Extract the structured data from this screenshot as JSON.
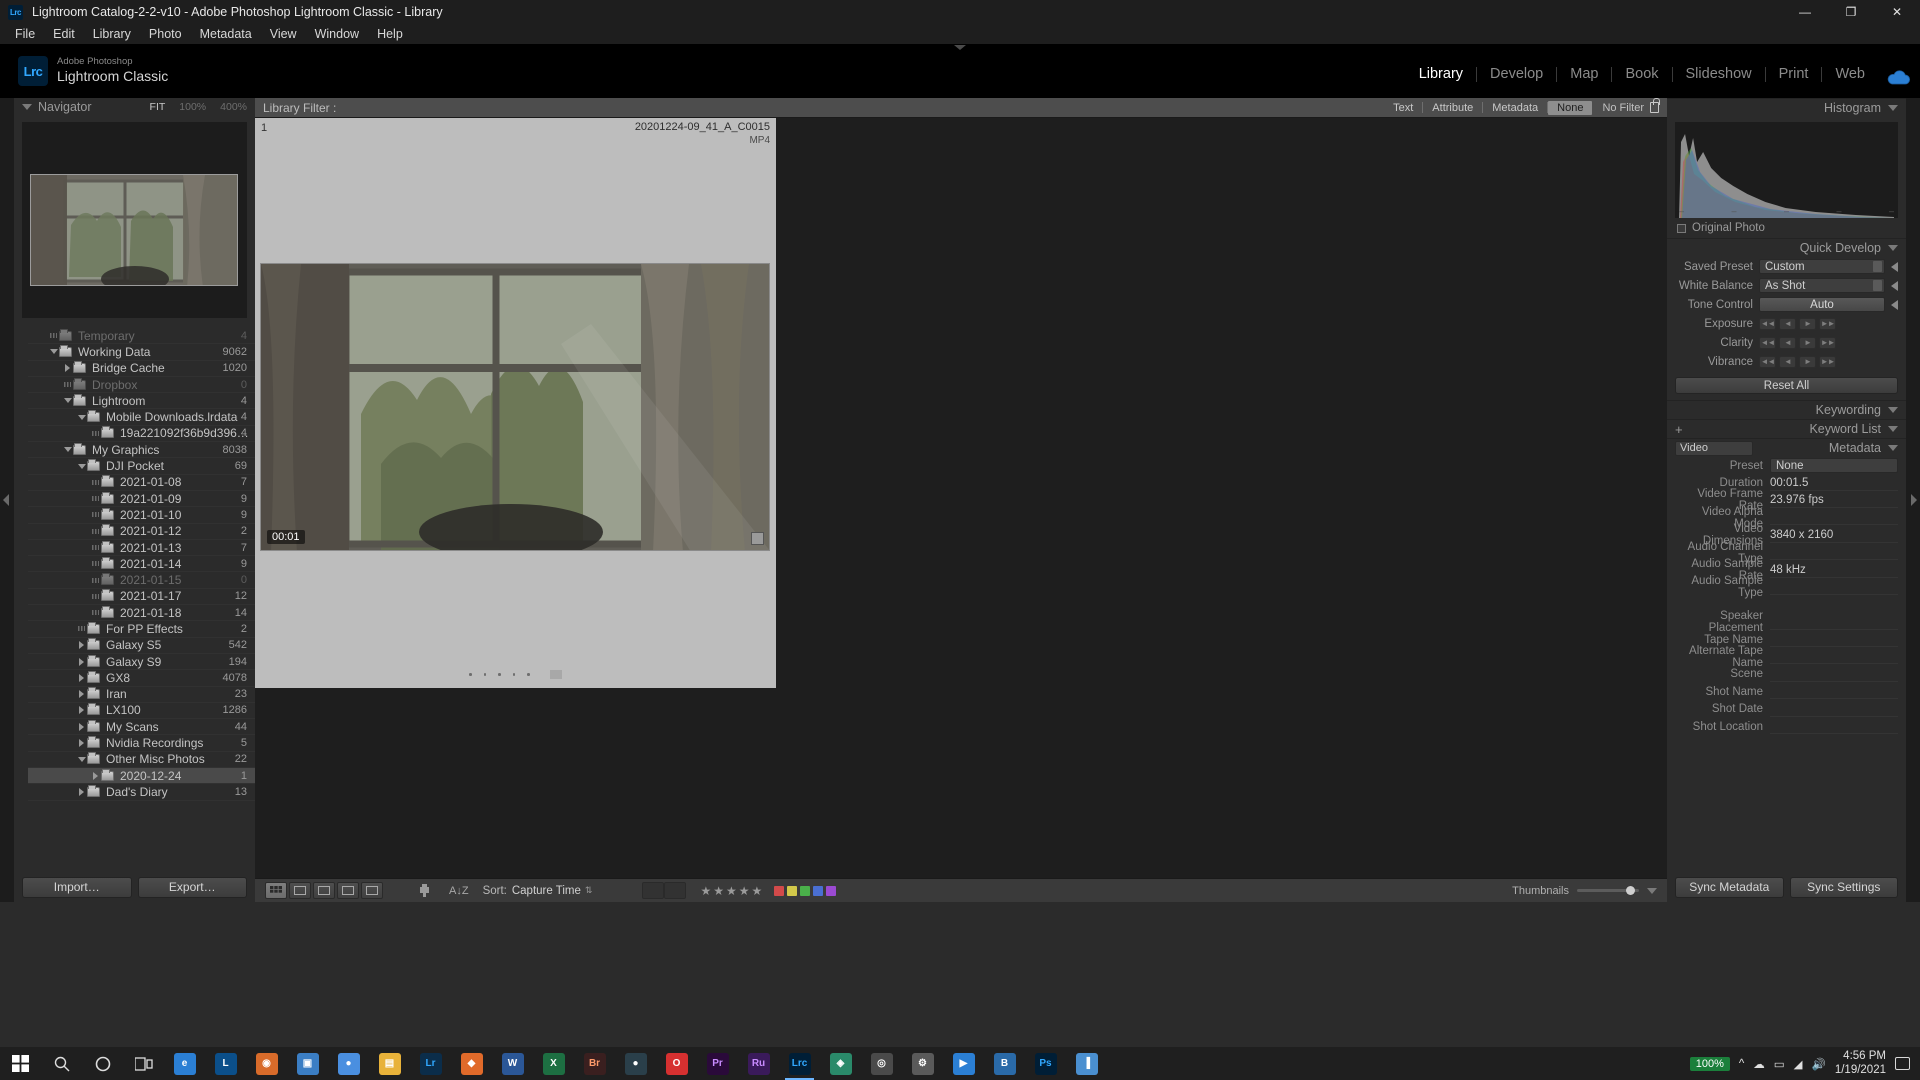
{
  "window": {
    "title": "Lightroom Catalog-2-2-v10 - Adobe Photoshop Lightroom Classic - Library",
    "app_badge": "Lrc",
    "minimize": "—",
    "maximize": "❐",
    "close": "✕"
  },
  "menu": [
    "File",
    "Edit",
    "Library",
    "Photo",
    "Metadata",
    "View",
    "Window",
    "Help"
  ],
  "identity": {
    "line1": "Adobe Photoshop",
    "line2": "Lightroom Classic",
    "badge": "Lrc"
  },
  "modules": [
    {
      "label": "Library",
      "active": true
    },
    {
      "label": "Develop",
      "active": false
    },
    {
      "label": "Map",
      "active": false
    },
    {
      "label": "Book",
      "active": false
    },
    {
      "label": "Slideshow",
      "active": false
    },
    {
      "label": "Print",
      "active": false
    },
    {
      "label": "Web",
      "active": false
    }
  ],
  "navigator": {
    "title": "Navigator",
    "zoom_levels": [
      {
        "label": "FIT",
        "active": true
      },
      {
        "label": "100%",
        "active": false
      },
      {
        "label": "400%",
        "active": false
      }
    ]
  },
  "folders": [
    {
      "name": "Temporary",
      "count": "4",
      "indent": 1,
      "twisty": "dots",
      "dim": true,
      "selected": false
    },
    {
      "name": "Working Data",
      "count": "9062",
      "indent": 1,
      "twisty": "down",
      "dim": false,
      "selected": false
    },
    {
      "name": "Bridge Cache",
      "count": "1020",
      "indent": 2,
      "twisty": "right",
      "dim": false,
      "selected": false
    },
    {
      "name": "Dropbox",
      "count": "0",
      "indent": 2,
      "twisty": "dots",
      "dim": true,
      "selected": false
    },
    {
      "name": "Lightroom",
      "count": "4",
      "indent": 2,
      "twisty": "down",
      "dim": false,
      "selected": false
    },
    {
      "name": "Mobile Downloads.lrdata",
      "count": "4",
      "indent": 3,
      "twisty": "down",
      "dim": false,
      "selected": false
    },
    {
      "name": "19a221092f36b9d396…",
      "count": "4",
      "indent": 4,
      "twisty": "dots",
      "dim": false,
      "selected": false
    },
    {
      "name": "My Graphics",
      "count": "8038",
      "indent": 2,
      "twisty": "down",
      "dim": false,
      "selected": false
    },
    {
      "name": "DJI Pocket",
      "count": "69",
      "indent": 3,
      "twisty": "down",
      "dim": false,
      "selected": false
    },
    {
      "name": "2021-01-08",
      "count": "7",
      "indent": 4,
      "twisty": "dots",
      "dim": false,
      "selected": false
    },
    {
      "name": "2021-01-09",
      "count": "9",
      "indent": 4,
      "twisty": "dots",
      "dim": false,
      "selected": false
    },
    {
      "name": "2021-01-10",
      "count": "9",
      "indent": 4,
      "twisty": "dots",
      "dim": false,
      "selected": false
    },
    {
      "name": "2021-01-12",
      "count": "2",
      "indent": 4,
      "twisty": "dots",
      "dim": false,
      "selected": false
    },
    {
      "name": "2021-01-13",
      "count": "7",
      "indent": 4,
      "twisty": "dots",
      "dim": false,
      "selected": false
    },
    {
      "name": "2021-01-14",
      "count": "9",
      "indent": 4,
      "twisty": "dots",
      "dim": false,
      "selected": false
    },
    {
      "name": "2021-01-15",
      "count": "0",
      "indent": 4,
      "twisty": "dots",
      "dim": true,
      "selected": false
    },
    {
      "name": "2021-01-17",
      "count": "12",
      "indent": 4,
      "twisty": "dots",
      "dim": false,
      "selected": false
    },
    {
      "name": "2021-01-18",
      "count": "14",
      "indent": 4,
      "twisty": "dots",
      "dim": false,
      "selected": false
    },
    {
      "name": "For PP Effects",
      "count": "2",
      "indent": 3,
      "twisty": "dots",
      "dim": false,
      "selected": false
    },
    {
      "name": "Galaxy S5",
      "count": "542",
      "indent": 3,
      "twisty": "right",
      "dim": false,
      "selected": false
    },
    {
      "name": "Galaxy S9",
      "count": "194",
      "indent": 3,
      "twisty": "right",
      "dim": false,
      "selected": false
    },
    {
      "name": "GX8",
      "count": "4078",
      "indent": 3,
      "twisty": "right",
      "dim": false,
      "selected": false
    },
    {
      "name": "Iran",
      "count": "23",
      "indent": 3,
      "twisty": "right",
      "dim": false,
      "selected": false
    },
    {
      "name": "LX100",
      "count": "1286",
      "indent": 3,
      "twisty": "right",
      "dim": false,
      "selected": false
    },
    {
      "name": "My Scans",
      "count": "44",
      "indent": 3,
      "twisty": "right",
      "dim": false,
      "selected": false
    },
    {
      "name": "Nvidia Recordings",
      "count": "5",
      "indent": 3,
      "twisty": "right",
      "dim": false,
      "selected": false
    },
    {
      "name": "Other Misc Photos",
      "count": "22",
      "indent": 3,
      "twisty": "down",
      "dim": false,
      "selected": false
    },
    {
      "name": "2020-12-24",
      "count": "1",
      "indent": 4,
      "twisty": "right",
      "dim": false,
      "selected": true
    },
    {
      "name": "Dad's Diary",
      "count": "13",
      "indent": 3,
      "twisty": "right",
      "dim": false,
      "selected": false
    }
  ],
  "left_buttons": {
    "import": "Import…",
    "export": "Export…"
  },
  "library_filter": {
    "label": "Library Filter :",
    "tabs": [
      {
        "label": "Text",
        "active": false
      },
      {
        "label": "Attribute",
        "active": false
      },
      {
        "label": "Metadata",
        "active": false
      },
      {
        "label": "None",
        "active": true
      }
    ],
    "no_filter": "No Filter",
    "lock_icon": "lock-icon"
  },
  "grid_cell": {
    "index": "1",
    "filename": "20201224-09_41_A_C0015",
    "filetype": "MP4",
    "duration_badge": "00:01",
    "crop_badge_icon": "crop-badge-icon"
  },
  "toolbar": {
    "view_buttons": [
      "grid-view-icon",
      "loupe-view-icon",
      "compare-view-icon",
      "survey-view-icon",
      "people-view-icon"
    ],
    "painter_icon": "spray-can-icon",
    "sort_icon": "sort-az-icon",
    "sort_label": "Sort:",
    "sort_value": "Capture Time",
    "flag_icons": [
      "flag-pick-icon",
      "flag-reject-icon"
    ],
    "stars": 5,
    "color_labels": [
      "#d24a4a",
      "#d2c84a",
      "#4ab04a",
      "#4a6fd2",
      "#9b4ad2"
    ],
    "thumbnails_label": "Thumbnails"
  },
  "histogram": {
    "title": "Histogram",
    "original_photo": "Original Photo"
  },
  "quick_develop": {
    "title": "Quick Develop",
    "rows": [
      {
        "label": "Saved Preset",
        "value": "Custom",
        "type": "select"
      },
      {
        "label": "White Balance",
        "value": "As Shot",
        "type": "select"
      },
      {
        "label": "Tone Control",
        "value": "Auto",
        "type": "button"
      },
      {
        "label": "Exposure",
        "value": "",
        "type": "steppers"
      },
      {
        "label": "Clarity",
        "value": "",
        "type": "steppers"
      },
      {
        "label": "Vibrance",
        "value": "",
        "type": "steppers"
      }
    ],
    "reset": "Reset All"
  },
  "keywording": {
    "title": "Keywording"
  },
  "keyword_list": {
    "title": "Keyword List",
    "add_icon": "plus-icon"
  },
  "metadata_panel": {
    "title": "Metadata",
    "preset_selector": "Video",
    "preset_label": "Preset",
    "preset_value": "None",
    "fields": [
      {
        "label": "Duration",
        "value": "00:01.5"
      },
      {
        "label": "Video Frame Rate",
        "value": "23.976 fps"
      },
      {
        "label": "Video Alpha Mode",
        "value": ""
      },
      {
        "label": "Video Dimensions",
        "value": "3840 x 2160"
      },
      {
        "label": "Audio Channel Type",
        "value": ""
      },
      {
        "label": "Audio Sample Rate",
        "value": "48 kHz"
      },
      {
        "label": "Audio Sample Type",
        "value": ""
      },
      {
        "label": "",
        "value": ""
      },
      {
        "label": "Speaker Placement",
        "value": ""
      },
      {
        "label": "Tape Name",
        "value": ""
      },
      {
        "label": "Alternate Tape Name",
        "value": ""
      },
      {
        "label": "Scene",
        "value": ""
      },
      {
        "label": "Shot Name",
        "value": ""
      },
      {
        "label": "Shot Date",
        "value": ""
      },
      {
        "label": "Shot Location",
        "value": ""
      }
    ]
  },
  "right_buttons": {
    "sync_metadata": "Sync Metadata",
    "sync_settings": "Sync Settings"
  },
  "taskbar": {
    "start_icon": "windows-start-icon",
    "search_icon": "search-icon",
    "cortana_icon": "cortana-circle-icon",
    "taskview_icon": "task-view-icon",
    "apps": [
      {
        "name": "edge-icon",
        "label": "e",
        "color": "#2b7fd4"
      },
      {
        "name": "lightroom-cc-icon",
        "label": "L",
        "color": "#0b4f8a"
      },
      {
        "name": "photos-icon",
        "label": "◉",
        "color": "#d86b2a"
      },
      {
        "name": "store-icon",
        "label": "▣",
        "color": "#3b7ec4"
      },
      {
        "name": "chrome-icon",
        "label": "●",
        "color": "#4a8fe0"
      },
      {
        "name": "explorer-icon",
        "label": "▤",
        "color": "#e8b23a"
      },
      {
        "name": "lightroom-icon",
        "label": "Lr",
        "color": "#0b2d4a"
      },
      {
        "name": "firefox-icon",
        "label": "◆",
        "color": "#e06a2a"
      },
      {
        "name": "word-icon",
        "label": "W",
        "color": "#2b5797"
      },
      {
        "name": "excel-icon",
        "label": "X",
        "color": "#1d6f42"
      },
      {
        "name": "bridge-icon",
        "label": "Br",
        "color": "#3a1f1f"
      },
      {
        "name": "steam-icon",
        "label": "●",
        "color": "#2a3f4a"
      },
      {
        "name": "opera-icon",
        "label": "O",
        "color": "#d63030"
      },
      {
        "name": "premiere-icon",
        "label": "Pr",
        "color": "#2a0a3a"
      },
      {
        "name": "rush-icon",
        "label": "Ru",
        "color": "#3a1a5a"
      },
      {
        "name": "lightroom-classic-icon",
        "label": "Lrc",
        "color": "#001e36",
        "active": true
      },
      {
        "name": "teams-icon",
        "label": "◈",
        "color": "#2a8a6a"
      },
      {
        "name": "disc-icon",
        "label": "◎",
        "color": "#4a4a4a"
      },
      {
        "name": "settings-icon",
        "label": "⚙",
        "color": "#5a5a5a"
      },
      {
        "name": "video-icon",
        "label": "▶",
        "color": "#2b7fd4"
      },
      {
        "name": "blender-icon",
        "label": "B",
        "color": "#2a6aa8"
      },
      {
        "name": "photoshop-icon",
        "label": "Ps",
        "color": "#001e36"
      },
      {
        "name": "phone-icon",
        "label": "▐",
        "color": "#4a8fd0"
      }
    ],
    "zoom_badge": "100%",
    "tray_icons": [
      "chevron-up-icon",
      "onedrive-icon",
      "battery-icon",
      "network-icon",
      "volume-icon"
    ],
    "time": "4:56 PM",
    "date": "1/19/2021",
    "notification_icon": "notification-icon"
  }
}
